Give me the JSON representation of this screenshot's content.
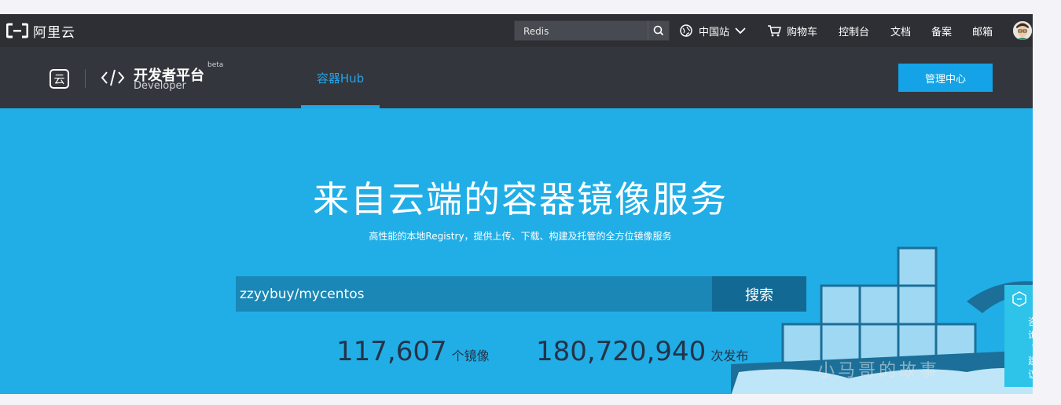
{
  "topbar": {
    "brand": "阿里云",
    "search_placeholder": "Redis",
    "region": "中国站",
    "cart": "购物车",
    "console": "控制台",
    "docs": "文档",
    "filing": "备案",
    "mail": "邮箱"
  },
  "subheader": {
    "title": "开发者平台",
    "subtitle": "Developer",
    "badge": "beta",
    "tab": "容器Hub",
    "manage_button": "管理中心"
  },
  "hero": {
    "title": "来自云端的容器镜像服务",
    "subtitle": "高性能的本地Registry，提供上传、下载、构建及托管的全方位镜像服务",
    "search_value": "zzyybuy/mycentos",
    "search_button": "搜索"
  },
  "stats": [
    {
      "value": "117,607",
      "unit": "个镜像"
    },
    {
      "value": "180,720,940",
      "unit": "次发布"
    }
  ],
  "float_widget": {
    "line1": "咨",
    "line2": "询",
    "dot": "·",
    "line3": "建",
    "line4": "议"
  },
  "colors": {
    "topbar": "#2d2f34",
    "subbar": "#34363d",
    "hero": "#21aee6",
    "accent": "#13a3e6"
  }
}
